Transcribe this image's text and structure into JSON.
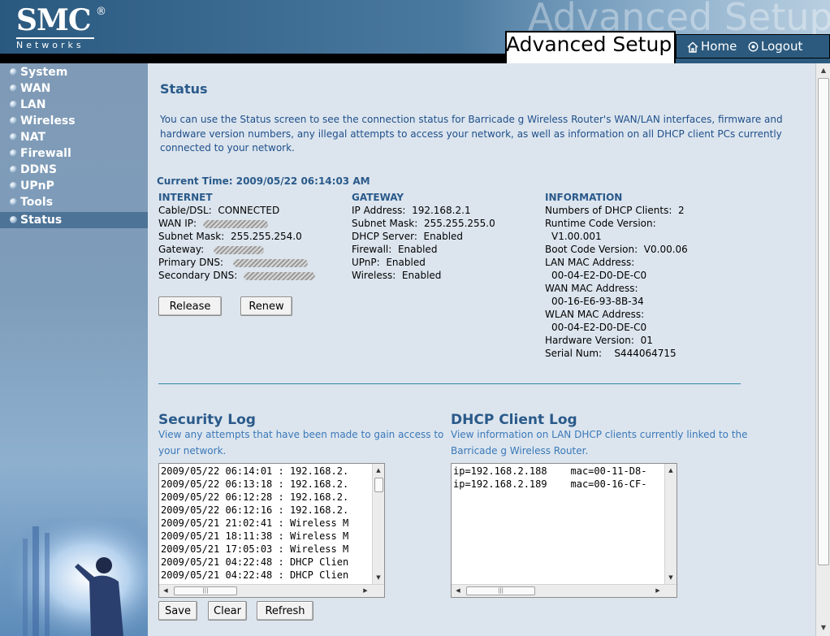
{
  "header": {
    "logo_text": "SMC",
    "logo_reg": "®",
    "logo_sub": "Networks",
    "watermark": "Advanced Setup",
    "title": "Advanced Setup",
    "home_label": "Home",
    "logout_label": "Logout"
  },
  "sidebar": {
    "items": [
      {
        "label": "System"
      },
      {
        "label": "WAN"
      },
      {
        "label": "LAN"
      },
      {
        "label": "Wireless"
      },
      {
        "label": "NAT"
      },
      {
        "label": "Firewall"
      },
      {
        "label": "DDNS"
      },
      {
        "label": "UPnP"
      },
      {
        "label": "Tools"
      },
      {
        "label": "Status"
      }
    ],
    "active": "Status"
  },
  "main": {
    "title": "Status",
    "intro": "You can use the Status screen to see the connection status for Barricade g Wireless Router's WAN/LAN interfaces, firmware and hardware version numbers, any illegal attempts to access your network, as well as information on all DHCP client PCs currently connected to your network.",
    "current_time_label": "Current Time:",
    "current_time": "2009/05/22 06:14:03 AM",
    "internet": {
      "title": "INTERNET",
      "cable_label": "Cable/DSL:",
      "cable_value": "CONNECTED",
      "wan_ip_label": "WAN IP:",
      "subnet_label": "Subnet Mask:",
      "subnet_value": "255.255.254.0",
      "gateway_label": "Gateway:",
      "pdns_label": "Primary DNS:",
      "sdns_label": "Secondary DNS:"
    },
    "gateway": {
      "title": "GATEWAY",
      "ip_label": "IP Address:",
      "ip_value": "192.168.2.1",
      "subnet_label": "Subnet Mask:",
      "subnet_value": "255.255.255.0",
      "dhcp_label": "DHCP Server:",
      "dhcp_value": "Enabled",
      "firewall_label": "Firewall:",
      "firewall_value": "Enabled",
      "upnp_label": "UPnP:",
      "upnp_value": "Enabled",
      "wireless_label": "Wireless:",
      "wireless_value": "Enabled"
    },
    "information": {
      "title": "INFORMATION",
      "dhcp_clients_label": "Numbers of DHCP Clients:",
      "dhcp_clients_value": "2",
      "runtime_label": "Runtime Code Version:",
      "runtime_value": "V1.00.001",
      "boot_label": "Boot Code Version:",
      "boot_value": "V0.00.06",
      "lan_mac_label": "LAN MAC Address:",
      "lan_mac_value": "00-04-E2-D0-DE-C0",
      "wan_mac_label": "WAN MAC Address:",
      "wan_mac_value": "00-16-E6-93-8B-34",
      "wlan_mac_label": "WLAN MAC Address:",
      "wlan_mac_value": "00-04-E2-D0-DE-C0",
      "hw_label": "Hardware Version:",
      "hw_value": "01",
      "serial_label": "Serial Num:",
      "serial_value": "S444064715"
    },
    "release_label": "Release",
    "renew_label": "Renew",
    "security_log": {
      "title": "Security Log",
      "desc_line1": "View any attempts that have been made to gain access to",
      "desc_line2": "your network.",
      "lines": [
        "2009/05/22 06:14:01 : 192.168.2.",
        "2009/05/22 06:13:18 : 192.168.2.",
        "2009/05/22 06:12:28 : 192.168.2.",
        "2009/05/22 06:12:16 : 192.168.2.",
        "2009/05/21 21:02:41 : Wireless M",
        "2009/05/21 18:11:38 : Wireless M",
        "2009/05/21 17:05:03 : Wireless M",
        "2009/05/21 04:22:48 : DHCP Clien",
        "2009/05/21 04:22:48 : DHCP Clien"
      ],
      "save_label": "Save",
      "clear_label": "Clear",
      "refresh_label": "Refresh"
    },
    "dhcp_log": {
      "title": "DHCP Client Log",
      "desc_line1": "View information on LAN DHCP clients currently linked to the",
      "desc_line2": "Barricade g Wireless Router.",
      "lines": [
        "ip=192.168.2.188    mac=00-11-D8-",
        "ip=192.168.2.189    mac=00-16-CF-"
      ]
    }
  },
  "colors": {
    "header_bg": "#2c5a7e",
    "sidebar_bg": "#7f9ab6",
    "content_bg": "#dce5ee",
    "title_color": "#2a5a8a",
    "divider": "#2f8aa8"
  },
  "icons": {
    "home": "home-icon",
    "logout": "power-icon"
  }
}
